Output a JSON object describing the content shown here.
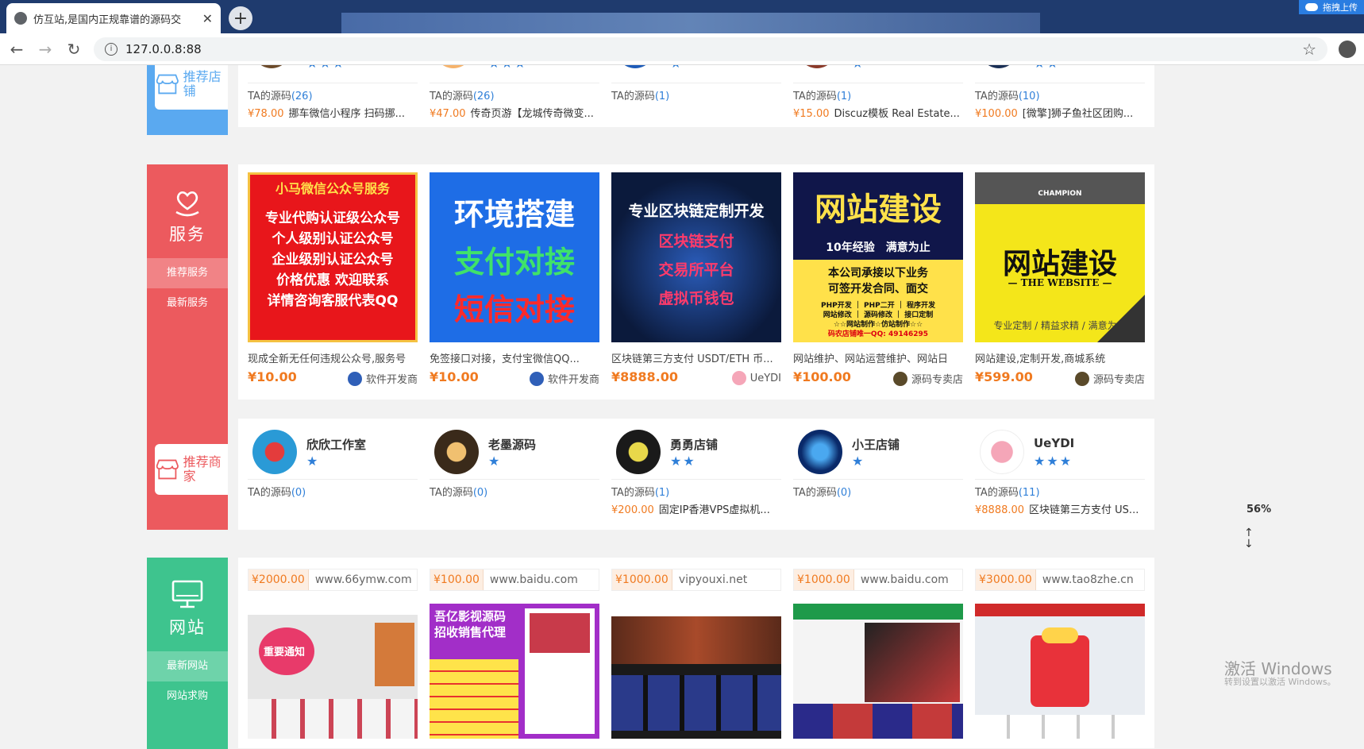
{
  "browser": {
    "tab_title": "仿互站,是国内正规靠谱的源码交",
    "url": "127.0.0.8:88",
    "upload_label": "拖拽上传"
  },
  "top_section": {
    "store_tag": "推荐店铺",
    "cards": [
      {
        "ta": "TA的源码",
        "count": "(26)",
        "price": "¥78.00",
        "title": "挪车微信小程序 扫码挪...",
        "stars": "★★★"
      },
      {
        "ta": "TA的源码",
        "count": "(26)",
        "price": "¥47.00",
        "title": "传奇页游【龙城传奇微变...",
        "stars": "★★★"
      },
      {
        "ta": "TA的源码",
        "count": "(1)",
        "price": "",
        "title": "",
        "stars": "★"
      },
      {
        "ta": "TA的源码",
        "count": "(1)",
        "price": "¥15.00",
        "title": "Discuz模板 Real Estate...",
        "stars": "★"
      },
      {
        "ta": "TA的源码",
        "count": "(10)",
        "price": "¥100.00",
        "title": "[微擎]狮子鱼社区团购...",
        "stars": "★★"
      }
    ]
  },
  "service_section": {
    "title": "服务",
    "items": [
      "推荐服务",
      "最新服务"
    ],
    "store_tag": "推荐商家",
    "products": [
      {
        "desc": "现成全新无任何违规公众号,服务号",
        "price": "¥10.00",
        "seller": "软件开发商",
        "img_lines": [
          "小马微信公众号服务",
          "专业代购认证级公众号",
          "个人级别认证公众号",
          "企业级别认证公众号",
          "价格优惠 欢迎联系",
          "详情咨询客服代表QQ"
        ]
      },
      {
        "desc": "免签接口对接，支付宝微信QQ...",
        "price": "¥10.00",
        "seller": "软件开发商",
        "img_lines": [
          "环境搭建",
          "支付对接",
          "短信对接"
        ]
      },
      {
        "desc": "区块链第三方支付 USDT/ETH 币...",
        "price": "¥8888.00",
        "seller": "UeYDI",
        "img_lines": [
          "专业区块链定制开发",
          "区块链支付",
          "交易所平台",
          "虚拟币钱包"
        ]
      },
      {
        "desc": "网站维护、网站运营维护、网站日",
        "price": "¥100.00",
        "seller": "源码专卖店",
        "img_lines": [
          "网站建设",
          "10年经验　满意为止",
          "本公司承接以下业务",
          "可签开发合同、面交",
          "PHP开发 ｜ PHP二开 ｜ 程序开发",
          "网站修改 ｜ 源码修改 ｜ 接口定制",
          "☆☆网站制作☆仿站制作☆☆",
          "码农店铺唯一QQ: 49146295"
        ]
      },
      {
        "desc": "网站建设,定制开发,商城系统",
        "price": "¥599.00",
        "seller": "源码专卖店",
        "img_lines": [
          "CHAMPION",
          "网站建设",
          "— THE WEBSITE —",
          "专业定制 / 精益求精 / 满意为止"
        ]
      }
    ],
    "shops": [
      {
        "name": "欣欣工作室",
        "stars": "★",
        "ta": "TA的源码",
        "count": "(0)",
        "price": "",
        "title": ""
      },
      {
        "name": "老墨源码",
        "stars": "★",
        "ta": "TA的源码",
        "count": "(0)",
        "price": "",
        "title": ""
      },
      {
        "name": "勇勇店铺",
        "stars": "★★",
        "ta": "TA的源码",
        "count": "(1)",
        "price": "¥200.00",
        "title": "固定IP香港VPS虚拟机..."
      },
      {
        "name": "小王店铺",
        "stars": "★",
        "ta": "TA的源码",
        "count": "(0)",
        "price": "",
        "title": ""
      },
      {
        "name": "UeYDI",
        "stars": "★★★",
        "ta": "TA的源码",
        "count": "(11)",
        "price": "¥8888.00",
        "title": "区块链第三方支付 US..."
      }
    ]
  },
  "website_section": {
    "title": "网站",
    "items": [
      "最新网站",
      "网站求购"
    ],
    "sites": [
      {
        "price": "¥2000.00",
        "domain": "www.66ymw.com",
        "shot_text": "重要通知"
      },
      {
        "price": "¥100.00",
        "domain": "www.baidu.com",
        "shot_text": "吾亿影视源码 招收销售代理"
      },
      {
        "price": "¥1000.00",
        "domain": "vipyouxi.net",
        "shot_text": ""
      },
      {
        "price": "¥1000.00",
        "domain": "www.baidu.com",
        "shot_text": ""
      },
      {
        "price": "¥3000.00",
        "domain": "www.tao8zhe.cn",
        "shot_text": ""
      }
    ]
  },
  "overlay": {
    "percent": "56%",
    "windows_mark": "激活 Windows",
    "windows_sub": "转到设置以激活 Windows。"
  }
}
